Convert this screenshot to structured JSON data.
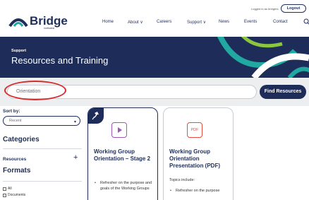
{
  "brand": {
    "name": "Bridge",
    "tagline": "northwest",
    "colors": {
      "navy": "#1d2c58",
      "teal": "#21a8a0",
      "green": "#8cc63f",
      "red_annotation": "#d62c2c"
    }
  },
  "header": {
    "login_text": "Logged in as bridgers",
    "logout_label": "Logout",
    "nav": [
      "Home",
      "About ∨",
      "Careers",
      "Support ∨",
      "News",
      "Events",
      "Contact"
    ],
    "search_icon": "search-icon"
  },
  "banner": {
    "eyebrow": "Support",
    "title": "Resources and Training"
  },
  "search": {
    "value": "Orientation",
    "button_label": "Find Resources"
  },
  "sidebar": {
    "sort_label": "Sort by:",
    "sort_value": "Recent",
    "categories_heading": "Categories",
    "resources_label": "Resources",
    "resources_toggle": "+",
    "formats_heading": "Formats",
    "format_options": [
      "All",
      "Documents"
    ]
  },
  "cards": [
    {
      "pinned": true,
      "icon": "video-play-icon",
      "title": "Working Group Orientation – Stage 2",
      "intro": "",
      "bullets": [
        "Refresher on the purpose and goals of the Working Groups"
      ]
    },
    {
      "pinned": false,
      "icon": "pdf-icon",
      "icon_label": "PDF",
      "title": "Working Group Orientation Presentation (PDF)",
      "intro": "Topics include:",
      "bullets": [
        "Refresher on the purpose"
      ]
    }
  ]
}
